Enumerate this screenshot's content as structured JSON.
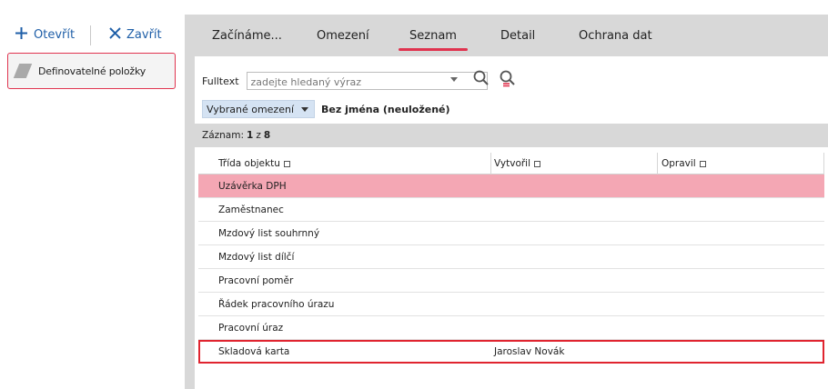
{
  "toolbar": {
    "open_label": "Otevřít",
    "close_label": "Zavřít"
  },
  "sidebar": {
    "item_label": "Definovatelné položky"
  },
  "tabs": [
    {
      "label": "Začínáme..."
    },
    {
      "label": "Omezení"
    },
    {
      "label": "Seznam"
    },
    {
      "label": "Detail"
    },
    {
      "label": "Ochrana dat"
    }
  ],
  "active_tab": "Seznam",
  "fulltext": {
    "label": "Fulltext",
    "placeholder": "zadejte hledaný výraz"
  },
  "filter": {
    "selected": "Vybrané omezení",
    "name": "Bez jména (neuložené)"
  },
  "record": {
    "label": "Záznam:",
    "current": "1",
    "of": "z",
    "total": "8"
  },
  "grid": {
    "columns": [
      "Třída objektu",
      "Vytvořil",
      "Opravil"
    ],
    "rows": [
      {
        "trida": "Uzávěrka DPH",
        "vytvoril": "",
        "opravil": ""
      },
      {
        "trida": "Zaměstnanec",
        "vytvoril": "",
        "opravil": ""
      },
      {
        "trida": "Mzdový list souhrnný",
        "vytvoril": "",
        "opravil": ""
      },
      {
        "trida": "Mzdový list dílčí",
        "vytvoril": "",
        "opravil": ""
      },
      {
        "trida": "Pracovní poměr",
        "vytvoril": "",
        "opravil": ""
      },
      {
        "trida": "Řádek pracovního úrazu",
        "vytvoril": "",
        "opravil": ""
      },
      {
        "trida": "Pracovní úraz",
        "vytvoril": "",
        "opravil": ""
      },
      {
        "trida": "Skladová karta",
        "vytvoril": "Jaroslav Novák",
        "opravil": ""
      }
    ]
  },
  "colors": {
    "accent": "#e0334f",
    "link": "#1f5fa8",
    "selected_row": "#f4a7b4",
    "filter_bg": "#d5e3f3"
  },
  "icons": {
    "open": "plus-icon",
    "close": "x-icon",
    "search": "search-icon",
    "search_clear": "search-clear-icon"
  }
}
